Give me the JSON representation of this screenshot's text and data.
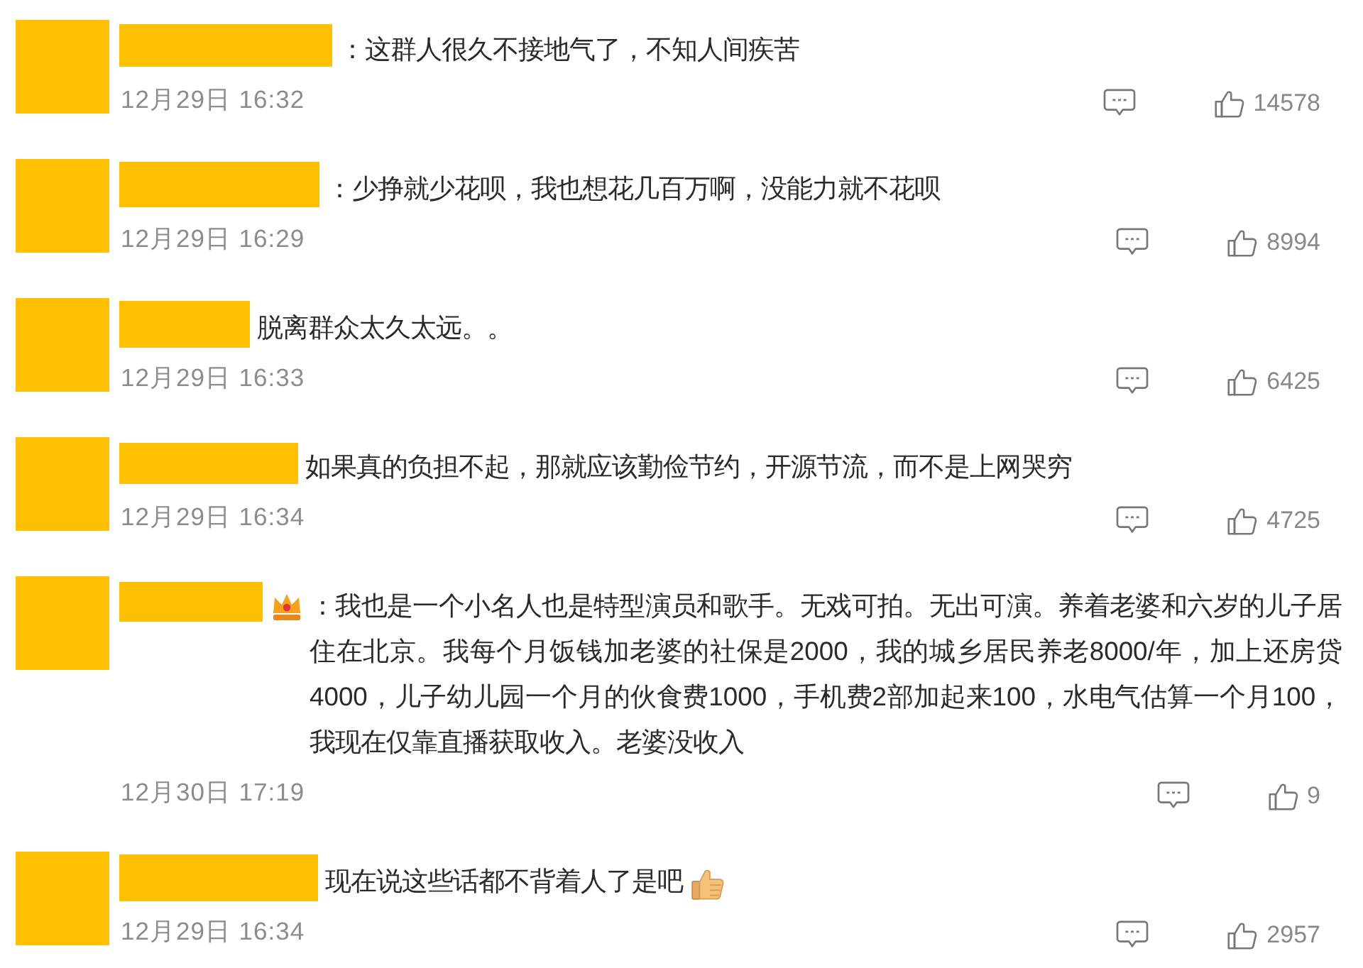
{
  "comments": [
    {
      "text": "：这群人很久不接地气了，不知人间疾苦",
      "badge": false,
      "trailing_emoji": false,
      "time": "12月29日 16:32",
      "likes": "14578"
    },
    {
      "text": "：少挣就少花呗，我也想花几百万啊，没能力就不花呗",
      "badge": false,
      "trailing_emoji": false,
      "time": "12月29日 16:29",
      "likes": "8994"
    },
    {
      "text": "脱离群众太久太远。。",
      "badge": false,
      "trailing_emoji": false,
      "time": "12月29日 16:33",
      "likes": "6425"
    },
    {
      "text": "如果真的负担不起，那就应该勤俭节约，开源节流，而不是上网哭穷",
      "badge": false,
      "trailing_emoji": false,
      "time": "12月29日 16:34",
      "likes": "4725"
    },
    {
      "text": "：我也是一个小名人也是特型演员和歌手。无戏可拍。无出可演。养着老婆和六岁的儿子居住在北京。我每个月饭钱加老婆的社保是2000，我的城乡居民养老8000/年，加上还房贷4000，儿子幼儿园一个月的伙食费1000，手机费2部加起来100，水电气估算一个月100，我现在仅靠直播获取收入。老婆没收入",
      "badge": true,
      "trailing_emoji": false,
      "time": "12月30日 17:19",
      "likes": "9"
    },
    {
      "text": "现在说这些话都不背着人了是吧",
      "badge": false,
      "trailing_emoji": true,
      "time": "12月29日 16:34",
      "likes": "2957"
    }
  ]
}
